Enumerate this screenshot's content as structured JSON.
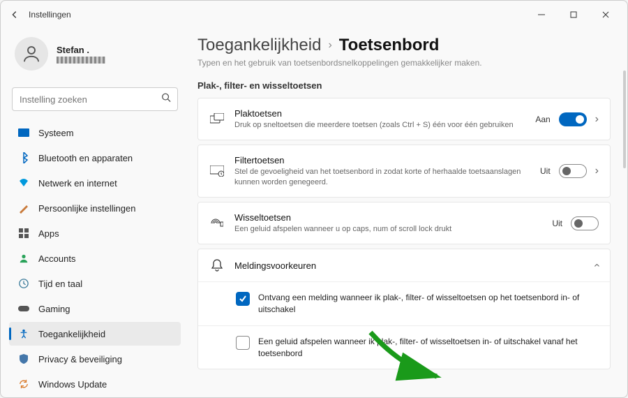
{
  "window": {
    "title": "Instellingen"
  },
  "profile": {
    "name": "Stefan ."
  },
  "search": {
    "placeholder": "Instelling zoeken"
  },
  "sidebar": {
    "items": [
      {
        "label": "Systeem",
        "icon": "system"
      },
      {
        "label": "Bluetooth en apparaten",
        "icon": "bluetooth"
      },
      {
        "label": "Netwerk en internet",
        "icon": "network"
      },
      {
        "label": "Persoonlijke instellingen",
        "icon": "personalization"
      },
      {
        "label": "Apps",
        "icon": "apps"
      },
      {
        "label": "Accounts",
        "icon": "accounts"
      },
      {
        "label": "Tijd en taal",
        "icon": "time"
      },
      {
        "label": "Gaming",
        "icon": "gaming"
      },
      {
        "label": "Toegankelijkheid",
        "icon": "accessibility",
        "active": true
      },
      {
        "label": "Privacy & beveiliging",
        "icon": "privacy"
      },
      {
        "label": "Windows Update",
        "icon": "update"
      }
    ]
  },
  "breadcrumb": {
    "parent": "Toegankelijkheid",
    "current": "Toetsenbord"
  },
  "truncated_desc": "Typen en het gebruik van toetsenbordsnelkoppelingen gemakkelijker maken.",
  "section": "Plak-, filter- en wisseltoetsen",
  "rows": {
    "sticky": {
      "title": "Plaktoetsen",
      "sub": "Druk op sneltoetsen die meerdere toetsen (zoals Ctrl + S) één voor één gebruiken",
      "state": "Aan"
    },
    "filter": {
      "title": "Filtertoetsen",
      "sub": "Stel de gevoeligheid van het toetsenbord in zodat korte of herhaalde toetsaanslagen kunnen worden genegeerd.",
      "state": "Uit"
    },
    "togglekeys": {
      "title": "Wisseltoetsen",
      "sub": "Een geluid afspelen wanneer u op caps, num of scroll lock drukt",
      "state": "Uit"
    },
    "prefs": {
      "title": "Meldingsvoorkeuren"
    }
  },
  "checks": {
    "c1": "Ontvang een melding wanneer ik plak-, filter- of wisseltoetsen op het toetsenbord in- of uitschakel",
    "c2": "Een geluid afspelen wanneer ik plak-, filter- of wisseltoetsen in- of uitschakel vanaf het toetsenbord"
  }
}
